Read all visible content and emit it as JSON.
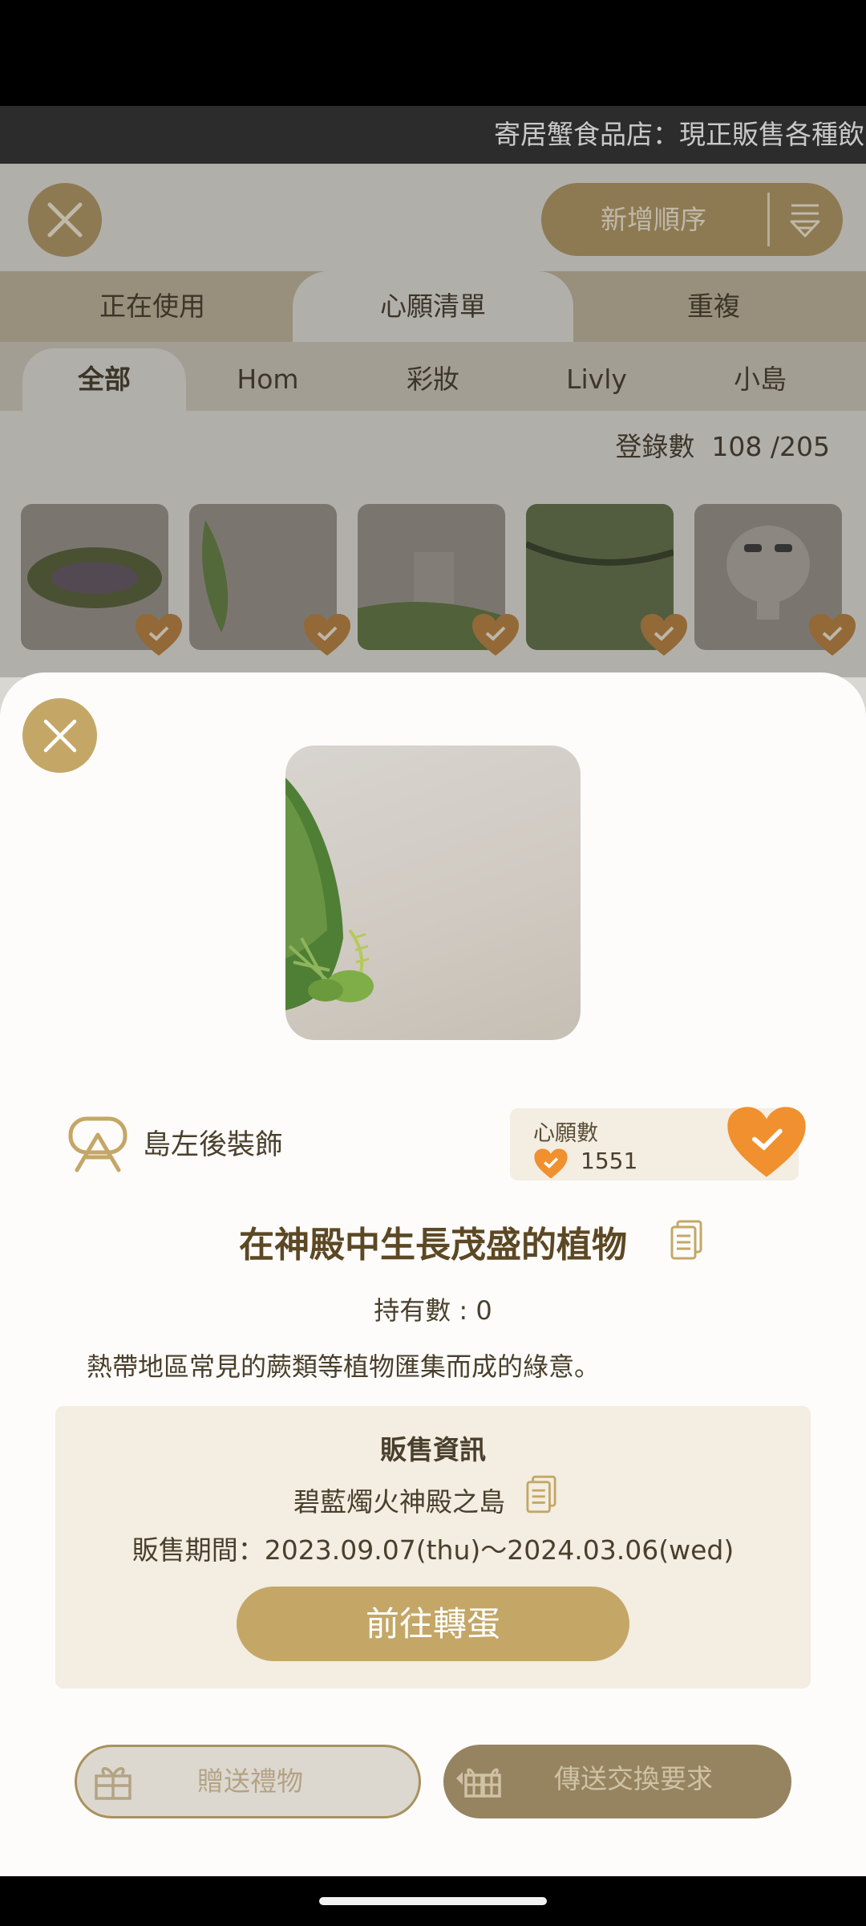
{
  "ticker": {
    "text": "寄居蟹食品店：現正販售各種飲"
  },
  "header": {
    "sort_label": "新增順序"
  },
  "tabs": [
    {
      "label": "正在使用"
    },
    {
      "label": "心願清單"
    },
    {
      "label": "重複"
    }
  ],
  "sub_tabs": [
    {
      "label": "全部"
    },
    {
      "label": "Hom"
    },
    {
      "label": "彩妝"
    },
    {
      "label": "Livly"
    },
    {
      "label": "小島"
    }
  ],
  "registration": {
    "label": "登錄數",
    "value": "108 /205"
  },
  "item": {
    "category": "島左後裝飾",
    "wish_title": "心願數",
    "wish_count": "1551",
    "name": "在神殿中生長茂盛的植物",
    "owned": "持有數 : 0",
    "description": "熱帶地區常見的蕨類等植物匯集而成的綠意。"
  },
  "sale": {
    "title": "販售資訊",
    "island": "碧藍燭火神殿之島",
    "period": "販售期間：2023.09.07(thu)〜2024.03.06(wed)",
    "button": "前往轉蛋"
  },
  "actions": {
    "gift": "贈送禮物",
    "trade": "傳送交換要求"
  },
  "colors": {
    "gold": "#c4a767",
    "heart": "#f0902e",
    "brown_text": "#5c4824"
  }
}
